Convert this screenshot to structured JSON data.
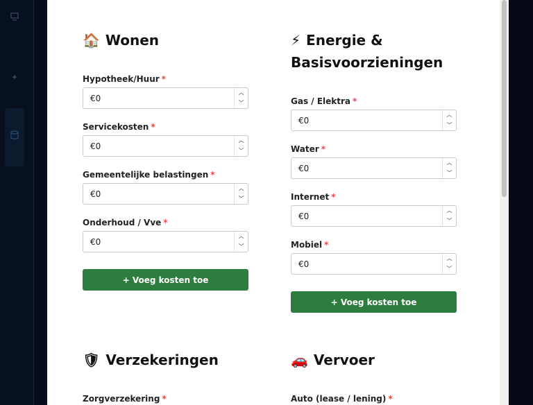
{
  "sidebar": {
    "icons": [
      "monitor-icon",
      "star-icon",
      "database-icon"
    ]
  },
  "sections": {
    "wonen": {
      "emoji": "🏠",
      "title": "Wonen",
      "fields": [
        {
          "label": "Hypotheek/Huur",
          "value": "€0"
        },
        {
          "label": "Servicekosten",
          "value": "€0"
        },
        {
          "label": "Gemeentelijke belastingen",
          "value": "€0"
        },
        {
          "label": "Onderhoud / Vve",
          "value": "€0"
        }
      ],
      "add_label": "+ Voeg kosten toe"
    },
    "energie": {
      "emoji": "⚡",
      "title_line1": "Energie &",
      "title_line2": "Basisvoorzieningen",
      "fields": [
        {
          "label": "Gas / Elektra",
          "value": "€0"
        },
        {
          "label": "Water",
          "value": "€0"
        },
        {
          "label": "Internet",
          "value": "€0"
        },
        {
          "label": "Mobiel",
          "value": "€0"
        }
      ],
      "add_label": "+ Voeg kosten toe"
    },
    "verzekeringen": {
      "emoji": "🛡",
      "title": "Verzekeringen",
      "fields": [
        {
          "label": "Zorgverzekering"
        }
      ]
    },
    "vervoer": {
      "emoji": "🚗",
      "title": "Vervoer",
      "fields": [
        {
          "label": "Auto (lease / lening)"
        }
      ]
    }
  },
  "required_marker": "*"
}
